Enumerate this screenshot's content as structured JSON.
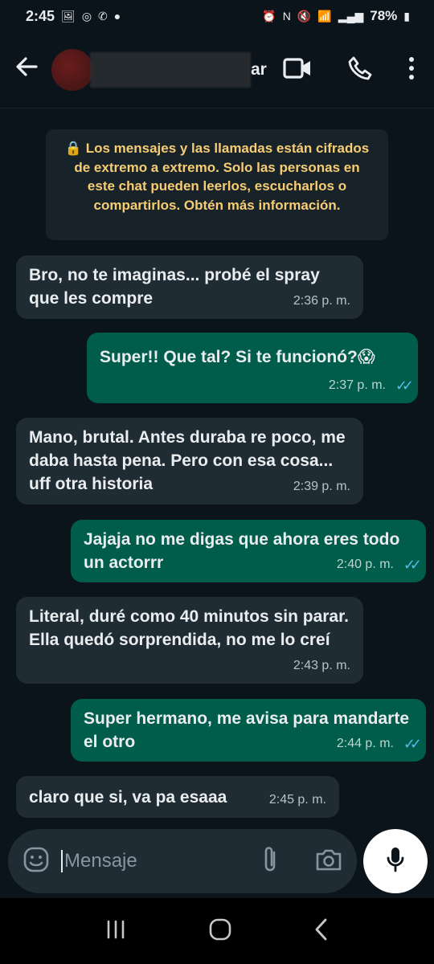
{
  "status": {
    "time": "2:45",
    "battery": "78%"
  },
  "header": {
    "name_fragment": "ar"
  },
  "e2e_notice": "🔒 Los mensajes y las llamadas están cifrados de extremo a extremo. Solo las personas en este chat pueden leerlos, escucharlos o compartirlos. Obtén más información.",
  "messages": [
    {
      "dir": "in",
      "text": "Bro, no te imaginas... probé el spray que les compre",
      "time": "2:36 p. m."
    },
    {
      "dir": "out",
      "text": "Super!! Que tal? Si te funcionó?😱",
      "time": "2:37 p. m."
    },
    {
      "dir": "in",
      "text": "Mano, brutal. Antes duraba re poco, me daba hasta pena. Pero con esa cosa... uff otra historia",
      "time": "2:39 p. m."
    },
    {
      "dir": "out",
      "text": "Jajaja no me digas que ahora eres todo un actorrr",
      "time": "2:40 p. m."
    },
    {
      "dir": "in",
      "text": "Literal, duré como 40 minutos sin parar. Ella quedó sorprendida, no me lo creí",
      "time": "2:43 p. m."
    },
    {
      "dir": "out",
      "text": "Super hermano, me avisa para mandarte el otro",
      "time": "2:44 p. m."
    },
    {
      "dir": "in",
      "text": "claro que si, va pa esaaa",
      "time": "2:45 p. m."
    }
  ],
  "input": {
    "placeholder": "Mensaje"
  },
  "colors": {
    "incoming": "#202c33",
    "outgoing": "#005c4b",
    "notice": "#f7cd73",
    "read_ticks": "#53bdeb"
  }
}
